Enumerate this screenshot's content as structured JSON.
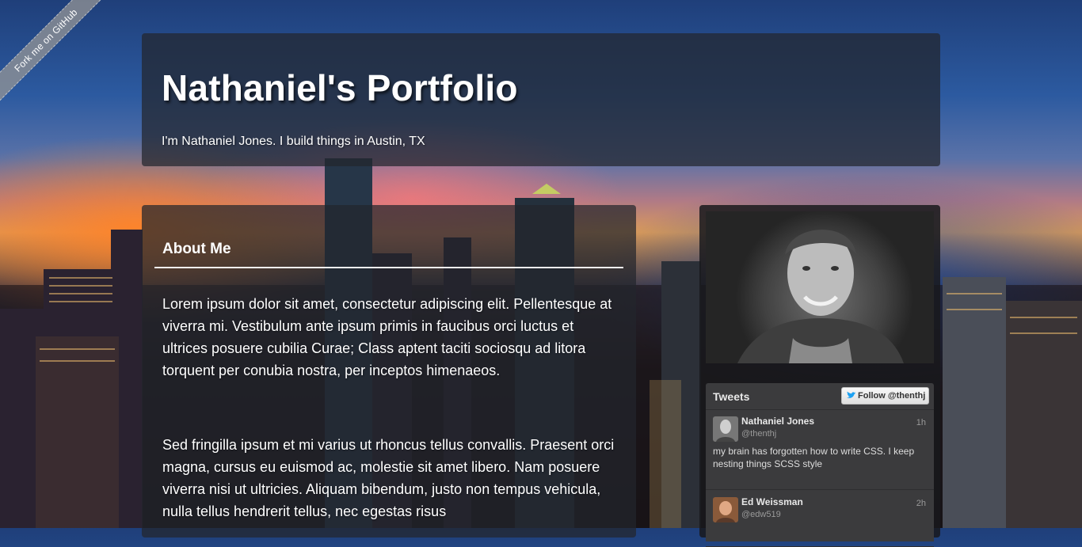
{
  "ribbon": {
    "label": "Fork me on GitHub"
  },
  "header": {
    "title": "Nathaniel's Portfolio",
    "tagline": "I'm Nathaniel Jones. I build things in Austin, TX"
  },
  "about": {
    "heading": "About Me",
    "paragraphs": [
      "Lorem ipsum dolor sit amet, consectetur adipiscing elit. Pellentesque at viverra mi. Vestibulum ante ipsum primis in faucibus orci luctus et ultrices posuere cubilia Curae; Class aptent taciti sociosqu ad litora torquent per conubia nostra, per inceptos himenaeos.",
      "Sed fringilla ipsum et mi varius ut rhoncus tellus convallis. Praesent orci magna, cursus eu euismod ac, molestie sit amet libero. Nam posuere viverra nisi ut ultricies. Aliquam bibendum, justo non tempus vehicula, nulla tellus hendrerit tellus, nec egestas risus"
    ]
  },
  "tweets": {
    "title": "Tweets",
    "follow_label": "Follow @thenthj",
    "items": [
      {
        "name": "Nathaniel Jones",
        "handle": "@thenthj",
        "time": "1h",
        "text": "my brain has forgotten how to write CSS. I keep nesting things SCSS style"
      },
      {
        "name": "Ed Weissman",
        "handle": "@edw519",
        "time": "2h",
        "text": ""
      }
    ]
  },
  "colors": {
    "twitter_blue": "#1da1f2",
    "panel": "#23262c"
  }
}
